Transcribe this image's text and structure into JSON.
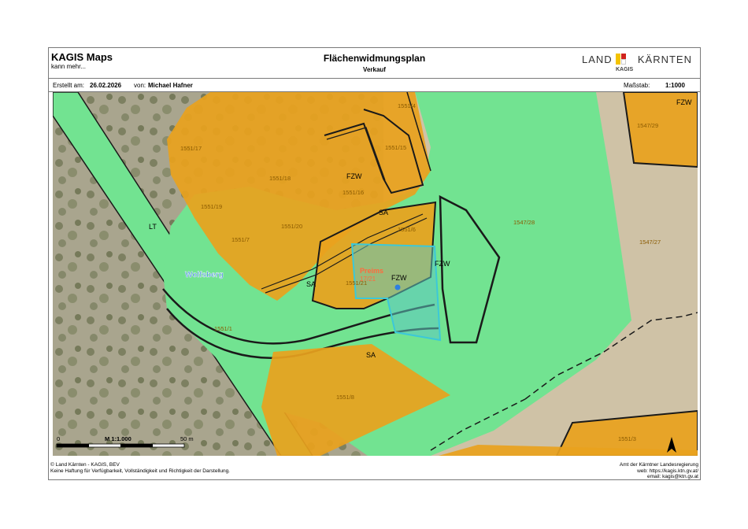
{
  "header": {
    "app_title": "KAGIS Maps",
    "app_subtitle": "kann mehr...",
    "title": "Flächenwidmungsplan",
    "subtitle": "Verkauf",
    "logo": {
      "left": "LAND",
      "right": "KÄRNTEN",
      "sub": "KAGIS",
      "icon": "carinthia-flag-icon"
    }
  },
  "info": {
    "created_label": "Erstellt am:",
    "created_value": "26.02.2026",
    "by_label": "von:",
    "by_value": "Michael Hafner",
    "scale_label": "Maßstab:",
    "scale_value": "1:1000"
  },
  "map": {
    "zone_labels": [
      "FZW",
      "FZW",
      "FZW",
      "FZW",
      "SA",
      "SA",
      "SA"
    ],
    "parcel_labels": [
      "1551/17",
      "1551/18",
      "1551/16",
      "1551/15",
      "1551/19",
      "1551/20",
      "1551/7",
      "1551/6",
      "1551/21",
      "1547/28",
      "1547/27",
      "1547/29",
      "1551/8",
      "1551/3",
      "1551/1",
      "1551/4"
    ],
    "road_label_lt": "LT",
    "street_label": "Wolfsberg",
    "place_label": "Preims",
    "place_number": "17/21",
    "scalebar": {
      "zero": "0",
      "ratio": "M 1:1.000",
      "end": "50 m"
    },
    "colors": {
      "green": "#6fe38e",
      "orange": "#e9a21d",
      "selection": "#3cc8d8",
      "outline": "#1a1a1a"
    }
  },
  "footer": {
    "left_line1": "© Land Kärnten - KAGIS, BEV",
    "left_line2": "Keine Haftung für Verfügbarkeit, Vollständigkeit und Richtigkeit der Darstellung.",
    "right_line1": "Amt der Kärntner Landesregierung",
    "right_line2": "web: https://kagis.ktn.gv.at/",
    "right_line3": "email: kagis@ktn.gv.at"
  }
}
